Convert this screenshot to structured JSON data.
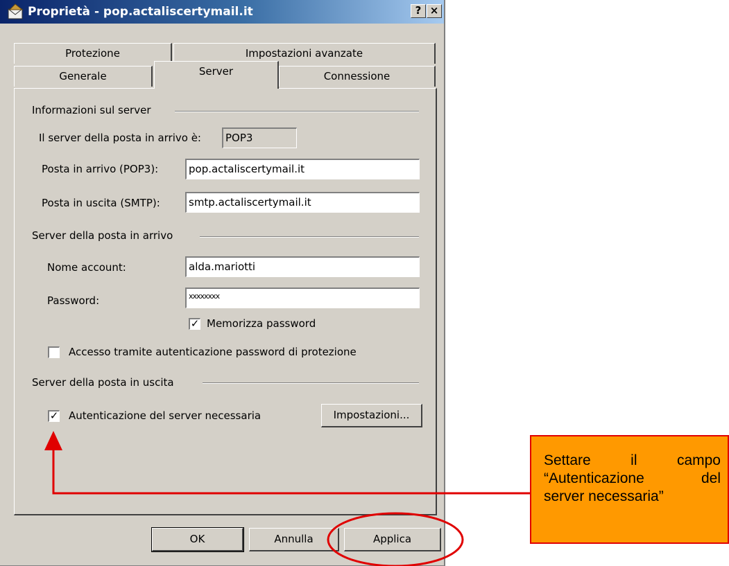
{
  "window": {
    "title": "Proprietà - pop.actaliscertymail.it",
    "help_button": "?",
    "close_button": "×"
  },
  "tabs": {
    "row1": [
      "Protezione",
      "Impostazioni avanzate"
    ],
    "row2": [
      "Generale",
      "Server",
      "Connessione"
    ],
    "active": "Server"
  },
  "server_info": {
    "group_label": "Informazioni sul server",
    "incoming_type_label": "Il server della posta in arrivo è:",
    "incoming_type_value": "POP3",
    "incoming_label": "Posta in arrivo (POP3):",
    "incoming_value": "pop.actaliscertymail.it",
    "outgoing_label": "Posta in uscita (SMTP):",
    "outgoing_value": "smtp.actaliscertymail.it"
  },
  "incoming_server": {
    "group_label": "Server della posta in arrivo",
    "account_label": "Nome account:",
    "account_value": "alda.mariotti",
    "password_label": "Password:",
    "password_value": "xxxxxxxx",
    "remember_label": "Memorizza password",
    "remember_checked": true,
    "spa_label": "Accesso tramite autenticazione password di protezione",
    "spa_checked": false
  },
  "outgoing_server": {
    "group_label": "Server della posta in uscita",
    "auth_label": "Autenticazione del server necessaria",
    "auth_checked": true,
    "settings_button": "Impostazioni..."
  },
  "buttons": {
    "ok": "OK",
    "cancel": "Annulla",
    "apply": "Applica"
  },
  "annotation": {
    "lines": [
      "Settare il campo",
      "“Autenticazione del",
      "server necessaria”"
    ],
    "border_color": "#e00000",
    "fill_color": "#ff9900",
    "arrow_color": "#e00000"
  }
}
